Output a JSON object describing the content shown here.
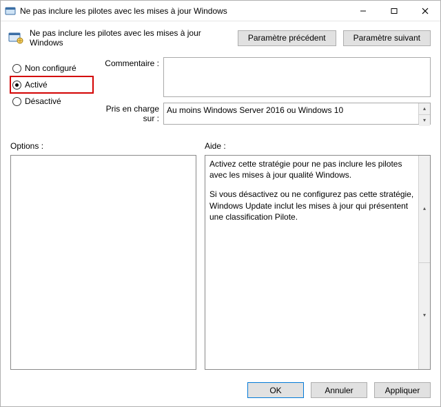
{
  "window": {
    "title": "Ne pas inclure les pilotes avec les mises à jour Windows"
  },
  "header": {
    "subtitle": "Ne pas inclure les pilotes avec les mises à jour Windows",
    "prev_param": "Paramètre précédent",
    "next_param": "Paramètre suivant"
  },
  "radios": {
    "not_configured": "Non configuré",
    "enabled": "Activé",
    "disabled": "Désactivé",
    "selected": "enabled"
  },
  "fields": {
    "comment_label": "Commentaire :",
    "comment_value": "",
    "supported_label": "Pris en charge sur :",
    "supported_value": "Au moins Windows Server 2016 ou Windows 10"
  },
  "panes": {
    "options_label": "Options :",
    "options_value": "",
    "help_label": "Aide :",
    "help_p1": "Activez cette stratégie pour ne pas inclure les pilotes avec les mises à jour qualité Windows.",
    "help_p2": "Si vous désactivez ou ne configurez pas cette stratégie, Windows Update inclut les mises à jour qui présentent une classification Pilote."
  },
  "footer": {
    "ok": "OK",
    "cancel": "Annuler",
    "apply": "Appliquer"
  }
}
